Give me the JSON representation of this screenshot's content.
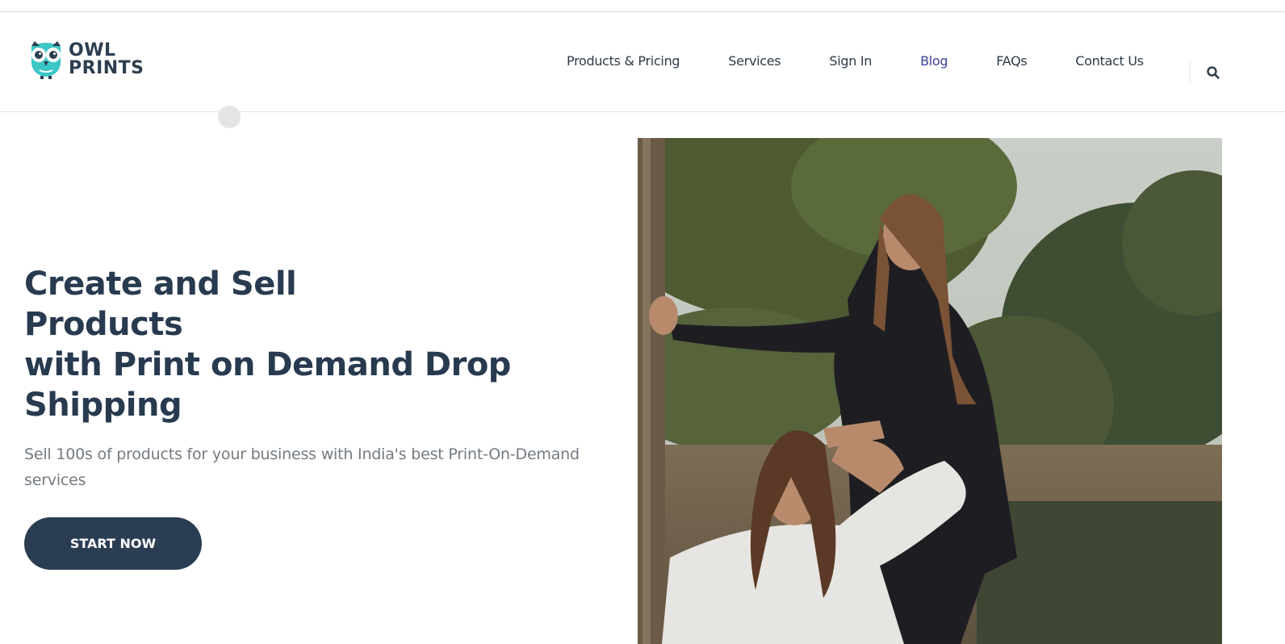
{
  "brand": {
    "line1": "OWL",
    "line2": "PRINTS",
    "icon": "owl-logo-icon",
    "colors": {
      "teal": "#3cc6c6",
      "dark": "#2c3e50"
    }
  },
  "nav": {
    "items": [
      {
        "label": "Products & Pricing",
        "active": false
      },
      {
        "label": "Services",
        "active": false
      },
      {
        "label": "Sign In",
        "active": false
      },
      {
        "label": "Blog",
        "active": true
      },
      {
        "label": "FAQs",
        "active": false
      },
      {
        "label": "Contact Us",
        "active": false
      }
    ],
    "search_icon": "search-icon",
    "active_color": "#3a3f9a"
  },
  "hero": {
    "title_lines": [
      "Create and Sell",
      "Products",
      "with Print on Demand Drop",
      "Shipping"
    ],
    "subtitle": "Sell 100s of products for your business with India's best Print-On-Demand services",
    "cta_label": "START NOW",
    "colors": {
      "title": "#283a4f",
      "button": "#2b3d52"
    }
  }
}
